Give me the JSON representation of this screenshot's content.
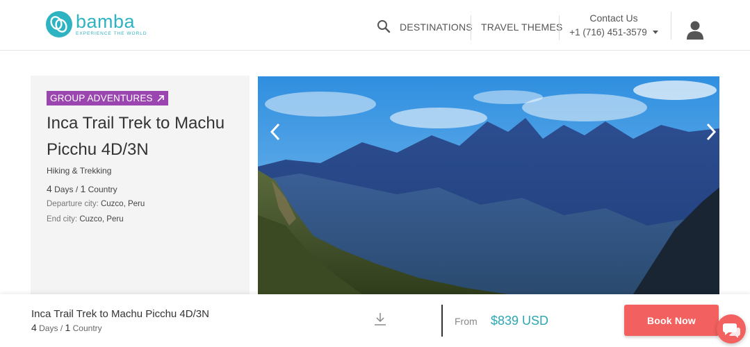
{
  "header": {
    "logo_name": "bamba",
    "logo_tagline": "EXPERIENCE THE WORLD",
    "nav": {
      "destinations": "DESTINATIONS",
      "travel_themes": "TRAVEL THEMES"
    },
    "contact": {
      "title": "Contact Us",
      "phone": "+1 (716) 451-3579"
    },
    "icons": [
      "search-icon",
      "chevron-down-icon",
      "user-icon"
    ]
  },
  "trip": {
    "badge": "GROUP ADVENTURES",
    "title": "Inca Trail Trek to Machu Picchu 4D/3N",
    "theme": "Hiking & Trekking",
    "days_num": "4",
    "days_label": "Days /",
    "country_num": "1",
    "country_label": "Country",
    "departure_label": "Departure city:",
    "departure_value": "Cuzco, Peru",
    "end_label": "End city:",
    "end_value": "Cuzco, Peru"
  },
  "gallery": {
    "icons": [
      "chevron-left-icon",
      "chevron-right-icon"
    ]
  },
  "bottom_bar": {
    "title": "Inca Trail Trek to Machu Picchu 4D/3N",
    "days_num": "4",
    "days_label": "Days /",
    "country_num": "1",
    "country_label": "Country",
    "from_label": "From",
    "price": "$839 USD",
    "book_label": "Book Now"
  },
  "colors": {
    "brand": "#2db3c1",
    "badge": "#9b45b0",
    "cta": "#f26160",
    "price": "#2aa7b3"
  }
}
